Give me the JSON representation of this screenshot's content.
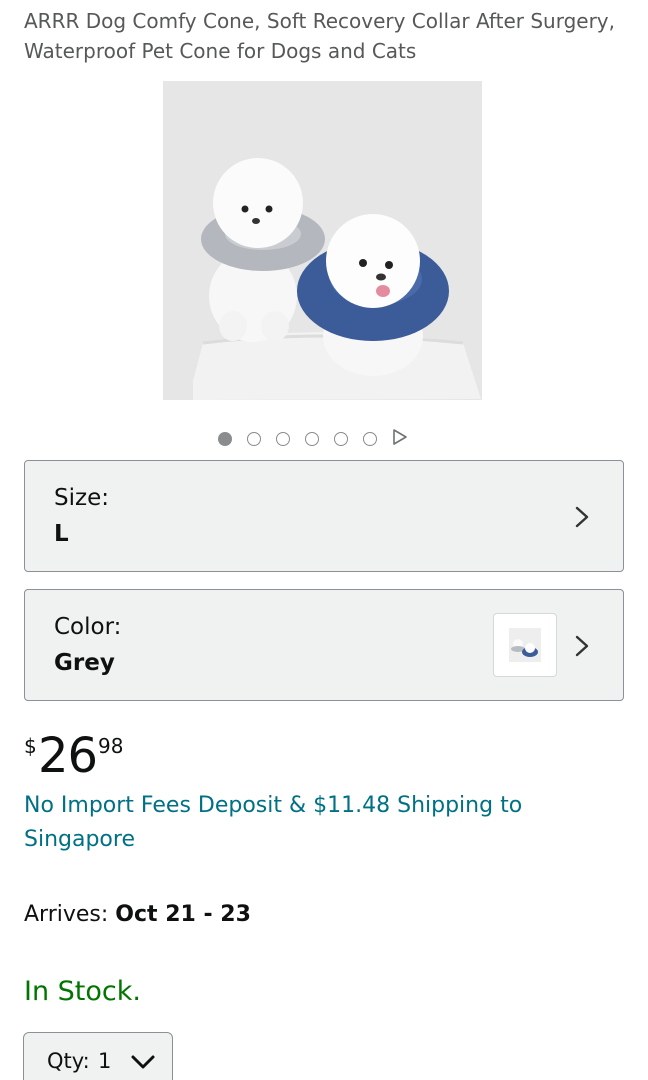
{
  "product": {
    "title": "ARRR Dog Comfy Cone, Soft Recovery Collar After Surgery, Waterproof Pet Cone for Dogs and Cats",
    "image_alt": "Two white dogs wearing grey and blue soft cones"
  },
  "gallery": {
    "dot_count": 6,
    "active_index": 0,
    "play_icon": "play-icon"
  },
  "size_selector": {
    "label": "Size:",
    "value": "L",
    "icon": "chevron-right-icon"
  },
  "color_selector": {
    "label": "Color:",
    "value": "Grey",
    "icon": "chevron-right-icon"
  },
  "price": {
    "symbol": "$",
    "whole": "26",
    "fraction": "98"
  },
  "shipping": {
    "text": "No Import Fees Deposit & $11.48 Shipping to Singapore"
  },
  "delivery": {
    "label": "Arrives: ",
    "dates": "Oct 21 - 23"
  },
  "availability": {
    "text": "In Stock."
  },
  "quantity": {
    "label": "Qty:",
    "value": "1",
    "icon": "chevron-down-icon"
  },
  "colors": {
    "link": "#007185",
    "in_stock": "#007600",
    "selector_bg": "#f0f2f2",
    "text_secondary": "#565959"
  }
}
